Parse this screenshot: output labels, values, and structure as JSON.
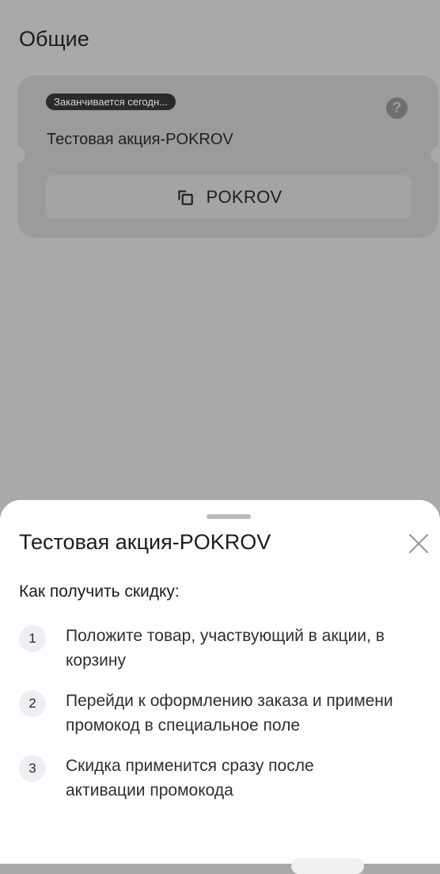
{
  "section": {
    "title": "Общие"
  },
  "promo_card": {
    "badge": "Заканчивается сегодн...",
    "help_glyph": "?",
    "name": "Тестовая акция-POKROV",
    "code": "POKROV"
  },
  "sheet": {
    "title": "Тестовая акция-POKROV",
    "heading": "Как получить скидку:",
    "steps": [
      {
        "num": "1",
        "line1": "Положите товар, участвующий в акции, в",
        "line2": "корзину"
      },
      {
        "num": "2",
        "line1": "Перейди к оформлению заказа и примени",
        "line2": "промокод в специальное поле"
      },
      {
        "num": "3",
        "line1": "Скидка применится сразу после",
        "line2": "активации промокода"
      }
    ]
  },
  "colors": {
    "overlay": "#a9a9a9",
    "card": "#9b9b9b",
    "sheet": "#ffffff",
    "badge_bg": "#2a2a2a"
  },
  "icons": {
    "help": "question-icon",
    "copy": "copy-icon",
    "close": "close-icon"
  }
}
